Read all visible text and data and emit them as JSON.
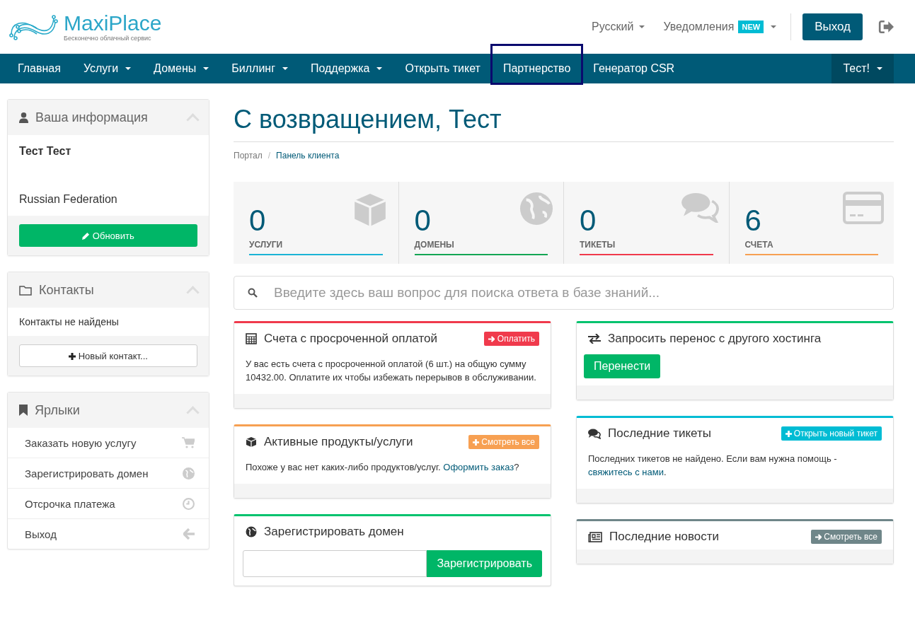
{
  "logo": {
    "name": "MaxiPlace",
    "tagline": "Бесконечно облачный сервис"
  },
  "header": {
    "language": "Русский",
    "notifications": "Уведомления",
    "badge": "NEW",
    "logout": "Выход"
  },
  "nav": {
    "items": [
      {
        "label": "Главная",
        "dropdown": false,
        "highlighted": false
      },
      {
        "label": "Услуги",
        "dropdown": true,
        "highlighted": false
      },
      {
        "label": "Домены",
        "dropdown": true,
        "highlighted": false
      },
      {
        "label": "Биллинг",
        "dropdown": true,
        "highlighted": false
      },
      {
        "label": "Поддержка",
        "dropdown": true,
        "highlighted": false
      },
      {
        "label": "Открыть тикет",
        "dropdown": false,
        "highlighted": false
      },
      {
        "label": "Партнерство",
        "dropdown": false,
        "highlighted": true
      },
      {
        "label": "Генератор CSR",
        "dropdown": false,
        "highlighted": false
      }
    ],
    "user": "Тест!"
  },
  "sidebar": {
    "info": {
      "title": "Ваша информация",
      "name": "Тест Тест",
      "country": "Russian Federation",
      "button": "Обновить"
    },
    "contacts": {
      "title": "Контакты",
      "empty": "Контакты не найдены",
      "button": "Новый контакт..."
    },
    "shortcuts": {
      "title": "Ярлыки",
      "items": [
        "Заказать новую услугу",
        "Зарегистрировать домен",
        "Отсрочка платежа",
        "Выход"
      ]
    }
  },
  "page": {
    "title": "С возвращением, Тест",
    "separator": "/",
    "breadcrumb": [
      {
        "label": "Портал",
        "selected": false
      },
      {
        "label": "Панель клиента",
        "selected": true
      }
    ]
  },
  "stats": [
    {
      "value": "0",
      "label": "УСЛУГИ",
      "color": "#1bb4d6"
    },
    {
      "value": "0",
      "label": "ДОМЕНЫ",
      "color": "#14a654"
    },
    {
      "value": "0",
      "label": "ТИКЕТЫ",
      "color": "#f03a4c"
    },
    {
      "value": "6",
      "label": "СЧЕТА",
      "color": "#f7a052"
    }
  ],
  "search": {
    "placeholder": "Введите здесь ваш вопрос для поиска ответа в базе знаний..."
  },
  "panels_left": [
    {
      "kind": "text",
      "title": "Счета с просроченной оплатой",
      "color": "#f03a4c",
      "action": "Оплатить",
      "text": "У вас есть счета с просроченной оплатой (6 шт.) на общую сумму 10432.00. Оплатите их чтобы избежать перерывов в обслуживании."
    },
    {
      "kind": "text",
      "title": "Активные продукты/услуги",
      "color": "#f7a052",
      "action": "Смотреть все",
      "text": "Похоже у вас нет каких-либо продуктов/услуг.",
      "link": "Оформить заказ",
      "after": "?"
    },
    {
      "kind": "domain",
      "title": "Зарегистрировать домен",
      "color": "#00c36e",
      "button": "Зарегистрировать"
    }
  ],
  "panels_right": [
    {
      "kind": "button",
      "title": "Запросить перенос с другого хостинга",
      "color": "#00c36e",
      "button": "Перенести"
    },
    {
      "kind": "text",
      "title": "Последние тикеты",
      "color": "#00bcd4",
      "action": "Открыть новый тикет",
      "text": "Последних тикетов не найдено. Если вам нужна помощь -",
      "link": "свяжитесь с нами",
      "after": "."
    },
    {
      "kind": "empty",
      "title": "Последние новости",
      "color": "#6f8689",
      "action": "Смотреть все"
    }
  ]
}
